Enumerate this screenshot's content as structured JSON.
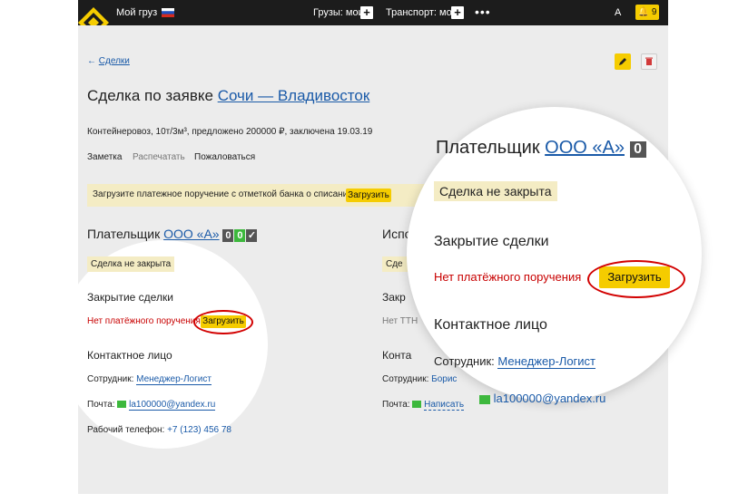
{
  "header": {
    "cargo_label": "Мой груз",
    "cargo_menu": "Грузы: мои",
    "transport_menu": "Транспорт: мой",
    "more": "•••",
    "user_initial": "А",
    "notifications_count": "9",
    "flag_icon": "russia-flag-icon",
    "plus_icon": "+"
  },
  "page": {
    "back_arrow": "←",
    "back_link": "Сделки",
    "title_prefix": "Сделка по заявке",
    "title_route": "Сочи — Владивосток",
    "meta": "Контейнеровоз, 10т/3м³, предложено 200000 ₽, заключена 19.03.19",
    "actions": {
      "note": "Заметка",
      "print": "Распечатать",
      "complain": "Пожаловаться"
    },
    "banner": {
      "text": "Загрузите платежное поручение с отметкой банка о списании",
      "button": "Загрузить"
    }
  },
  "payer": {
    "label": "Плательщик",
    "name": "ООО «А»",
    "score": [
      "0",
      "0",
      "✓"
    ],
    "status": "Сделка не закрыта",
    "closing_title": "Закрытие сделки",
    "no_payment": "Нет платёжного поручения",
    "upload": "Загрузить",
    "contact_title": "Контактное лицо",
    "employee_label": "Сотрудник:",
    "employee_name": "Менеджер-Логист",
    "email_label": "Почта:",
    "email": "la100000@yandex.ru",
    "phone_label": "Рабочий телефон:",
    "phone": "+7 (123) 456 78"
  },
  "executor": {
    "label": "Испо",
    "status": "Сде",
    "closing_title": "Закр",
    "no_ttn": "Нет ТТН",
    "contact_title": "Конта",
    "employee_label": "Сотрудник:",
    "employee_name": "Борис",
    "email_label": "Почта:",
    "write_link": "Написать"
  },
  "zoom": {
    "payer_label": "Плательщик",
    "payer_name": "ООО «А»",
    "score_first": "0",
    "status": "Сделка не закрыта",
    "closing_title": "Закрытие сделки",
    "no_payment": "Нет платёжного поручения",
    "upload": "Загрузить",
    "contact_title": "Контактное лицо",
    "employee_label": "Сотрудник:",
    "employee_name": "Менеджер-Логист",
    "email": "la100000@yandex.ru"
  },
  "colors": {
    "accent": "#f5cc00",
    "link": "#1a5aa8",
    "error": "#c80000",
    "highlight_ring": "#d20000"
  }
}
